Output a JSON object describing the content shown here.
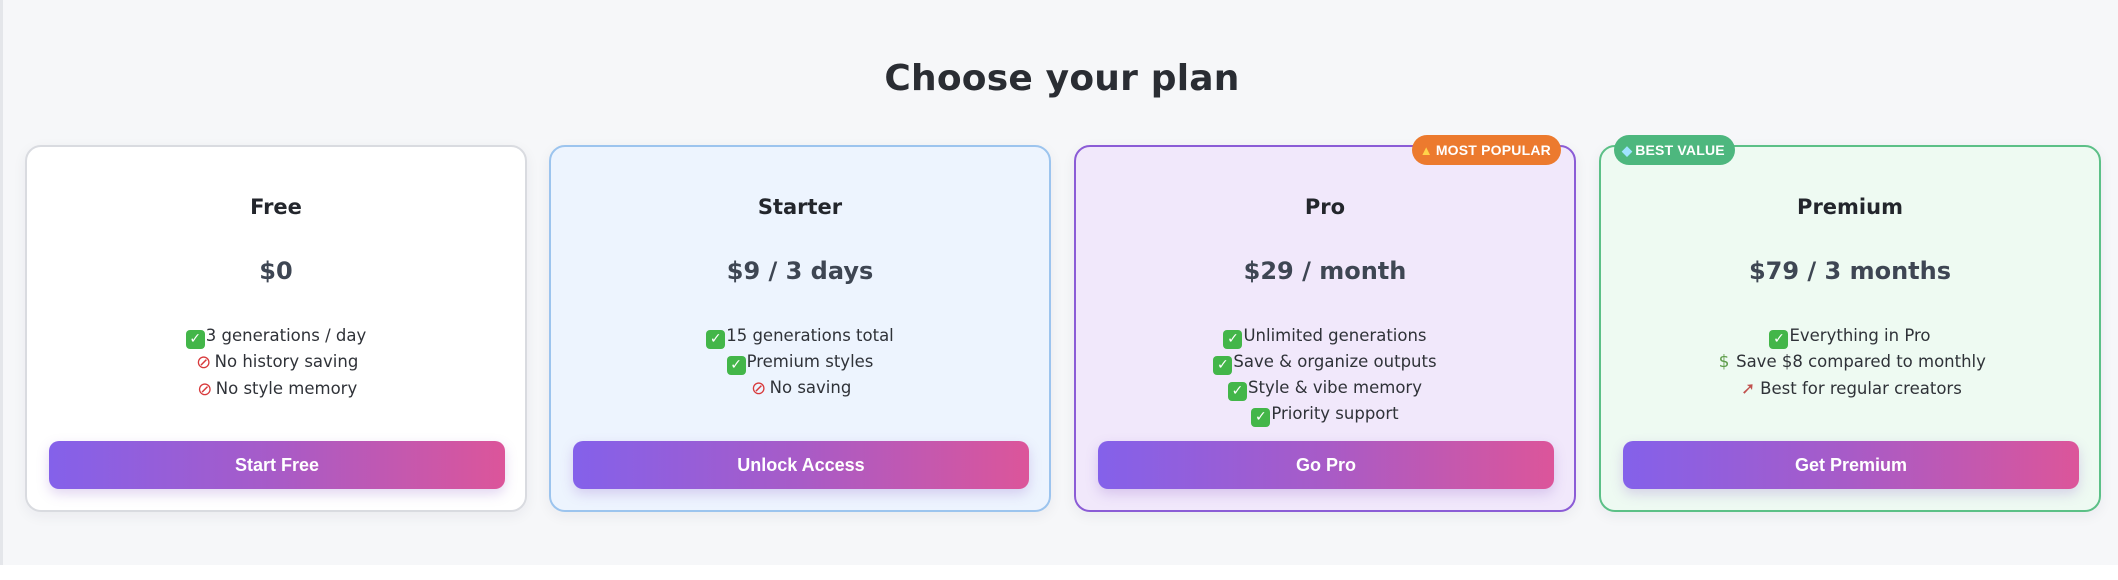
{
  "page": {
    "title": "Choose your plan"
  },
  "plans": [
    {
      "name": "Free",
      "price": "$0",
      "features": [
        {
          "icon": "check-icon",
          "text": "3 generations / day"
        },
        {
          "icon": "no-entry-icon",
          "text": "No history saving"
        },
        {
          "icon": "no-entry-icon",
          "text": "No style memory"
        }
      ],
      "cta": "Start Free"
    },
    {
      "name": "Starter",
      "price": "$9 / 3 days",
      "features": [
        {
          "icon": "check-icon",
          "text": "15 generations total"
        },
        {
          "icon": "check-icon",
          "text": "Premium styles"
        },
        {
          "icon": "no-entry-icon",
          "text": "No saving"
        }
      ],
      "cta": "Unlock Access"
    },
    {
      "name": "Pro",
      "price": "$29 / month",
      "badge": "MOST POPULAR",
      "badge_icon": "fire-icon",
      "features": [
        {
          "icon": "check-icon",
          "text": "Unlimited generations"
        },
        {
          "icon": "check-icon",
          "text": "Save & organize outputs"
        },
        {
          "icon": "check-icon",
          "text": "Style & vibe memory"
        },
        {
          "icon": "check-icon",
          "text": "Priority support"
        }
      ],
      "cta": "Go Pro"
    },
    {
      "name": "Premium",
      "price": "$79 / 3 months",
      "badge": "BEST VALUE",
      "badge_icon": "gem-icon",
      "features": [
        {
          "icon": "check-icon",
          "text": "Everything in Pro"
        },
        {
          "icon": "money-icon",
          "text": "Save $8 compared to monthly"
        },
        {
          "icon": "rocket-icon",
          "text": "Best for regular creators"
        }
      ],
      "cta": "Get Premium"
    }
  ],
  "colors": {
    "cta_gradient_start": "#8461ea",
    "cta_gradient_end": "#dc559a",
    "popular_badge": "#ec7a2e",
    "value_badge": "#4db77e",
    "pro_border": "#8b5cd6",
    "starter_border": "#9cc4ee",
    "premium_border": "#5cc087"
  }
}
